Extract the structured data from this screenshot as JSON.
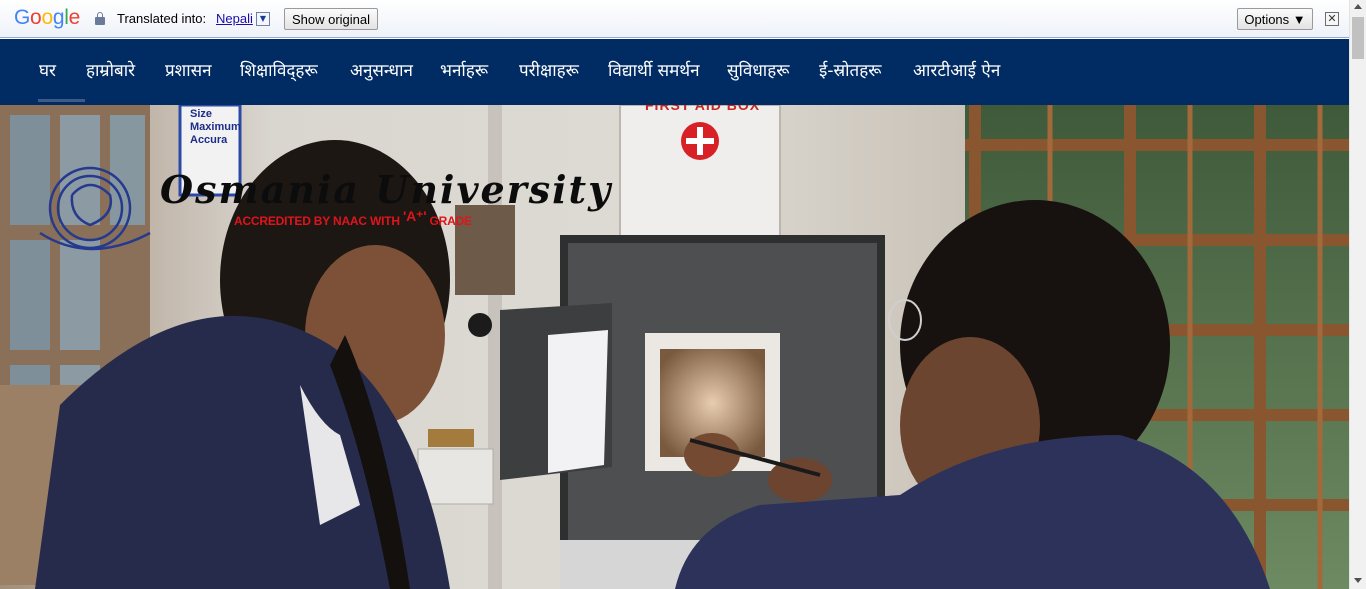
{
  "translate_bar": {
    "logo_letters": [
      {
        "char": "G",
        "color": "#4285f4"
      },
      {
        "char": "o",
        "color": "#ea4335"
      },
      {
        "char": "o",
        "color": "#fbbc05"
      },
      {
        "char": "g",
        "color": "#4285f4"
      },
      {
        "char": "l",
        "color": "#34a853"
      },
      {
        "char": "e",
        "color": "#ea4335"
      }
    ],
    "translated_into_label": "Translated into:",
    "language": "Nepali",
    "dropdown_glyph": "▼",
    "show_original_label": "Show original",
    "options_label": "Options ▼",
    "close_glyph": "✕",
    "lock_icon": "lock-icon"
  },
  "nav": {
    "items": [
      {
        "label": "घर",
        "active": true
      },
      {
        "label": "हाम्रोबारे"
      },
      {
        "label": "प्रशासन"
      },
      {
        "label": "शिक्षाविद्हरू"
      },
      {
        "label": "अनुसन्धान"
      },
      {
        "label": "भर्नाहरू"
      },
      {
        "label": "परीक्षाहरू"
      },
      {
        "label": "विद्यार्थी समर्थन"
      },
      {
        "label": "सुविधाहरू"
      },
      {
        "label": "ई-स्रोतहरू"
      },
      {
        "label": "आरटीआई ऐन"
      }
    ],
    "background": "#012b63"
  },
  "hero": {
    "university_name": "Osmania University",
    "accreditation_prefix": "ACCREDITED BY NAAC WITH ",
    "accreditation_grade": "'A⁺'",
    "accreditation_suffix": " GRADE",
    "first_aid_text": "FIRST AID BOX",
    "board_text": "Size Maximum Accura",
    "accent_red": "#e0141b"
  }
}
